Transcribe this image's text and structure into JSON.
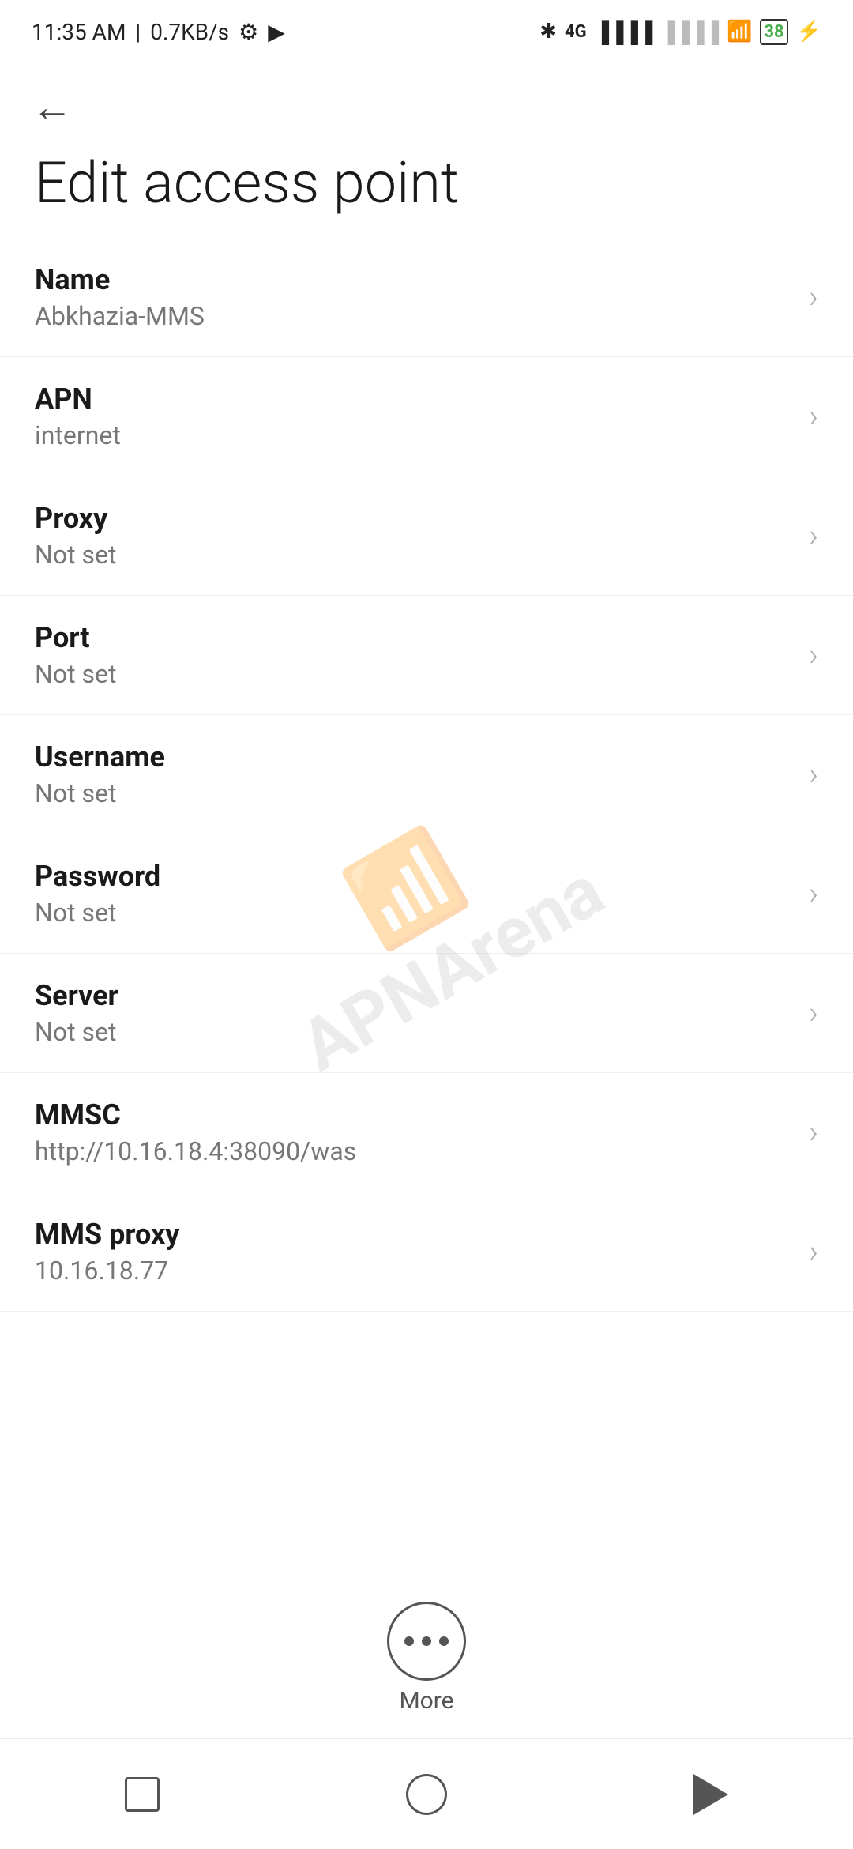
{
  "statusBar": {
    "time": "11:35 AM",
    "speed": "0.7KB/s"
  },
  "header": {
    "backLabel": "←",
    "title": "Edit access point"
  },
  "settings": [
    {
      "id": "name",
      "title": "Name",
      "value": "Abkhazia-MMS"
    },
    {
      "id": "apn",
      "title": "APN",
      "value": "internet"
    },
    {
      "id": "proxy",
      "title": "Proxy",
      "value": "Not set"
    },
    {
      "id": "port",
      "title": "Port",
      "value": "Not set"
    },
    {
      "id": "username",
      "title": "Username",
      "value": "Not set"
    },
    {
      "id": "password",
      "title": "Password",
      "value": "Not set"
    },
    {
      "id": "server",
      "title": "Server",
      "value": "Not set"
    },
    {
      "id": "mmsc",
      "title": "MMSC",
      "value": "http://10.16.18.4:38090/was"
    },
    {
      "id": "mms-proxy",
      "title": "MMS proxy",
      "value": "10.16.18.77"
    }
  ],
  "more": {
    "label": "More"
  },
  "watermark": {
    "text": "APNArena"
  }
}
